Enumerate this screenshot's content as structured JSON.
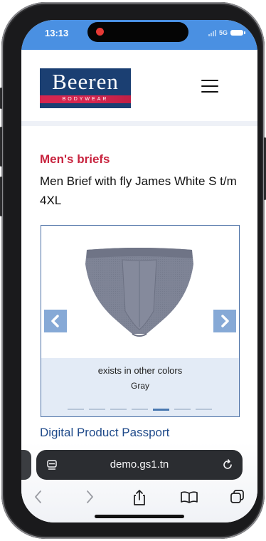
{
  "status_bar": {
    "time": "13:13",
    "network": "5G"
  },
  "header": {
    "logo_text": "Beeren",
    "logo_subtext": "BODYWEAR"
  },
  "product": {
    "category": "Men's briefs",
    "title": "Men Brief with fly James White S t/m 4XL",
    "carousel": {
      "caption": "exists in other colors",
      "color": "Gray",
      "slide_count": 7,
      "active_slide": 5
    }
  },
  "section_link": "Digital Product Passport",
  "browser": {
    "url": "demo.gs1.tn"
  },
  "colors": {
    "status_bar": "#4a90e2",
    "category": "#c8243f",
    "logo_bg": "#1b3f72",
    "link": "#1f4a8a"
  }
}
